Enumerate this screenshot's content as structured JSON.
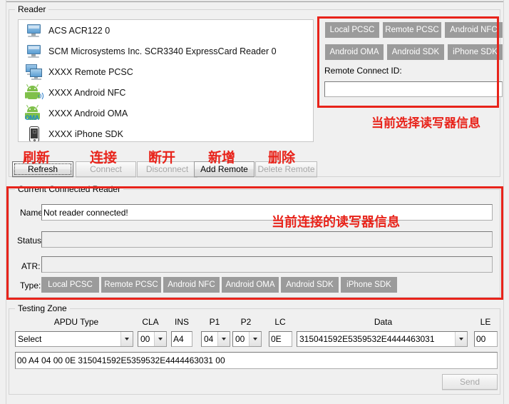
{
  "groups": {
    "reader": "Reader",
    "current": "Current Connected Reader",
    "testing": "Testing Zone"
  },
  "reader_list": [
    {
      "icon": "monitor-icon",
      "label": "ACS ACR122 0"
    },
    {
      "icon": "monitor-icon",
      "label": "SCM Microsystems Inc. SCR3340 ExpressCard Reader 0"
    },
    {
      "icon": "dual-monitor-icon",
      "label": "XXXX Remote PCSC"
    },
    {
      "icon": "android-nfc-icon",
      "label": "XXXX Android NFC"
    },
    {
      "icon": "android-oma-icon",
      "label": "XXXX Android OMA"
    },
    {
      "icon": "iphone-icon",
      "label": "XXXX iPhone SDK"
    }
  ],
  "type_chips": [
    "Local PCSC",
    "Remote PCSC",
    "Android NFC",
    "Android OMA",
    "Android SDK",
    "iPhone SDK"
  ],
  "remote": {
    "label": "Remote Connect ID:",
    "value": "",
    "placeholder": ""
  },
  "action_buttons": [
    {
      "label": "Refresh",
      "cn": "刷新",
      "disabled": false,
      "focused": true
    },
    {
      "label": "Connect",
      "cn": "连接",
      "disabled": true,
      "focused": false
    },
    {
      "label": "Disconnect",
      "cn": "断开",
      "disabled": true,
      "focused": false
    },
    {
      "label": "Add Remote",
      "cn": "新增",
      "disabled": false,
      "focused": false
    },
    {
      "label": "Delete Remote",
      "cn": "删除",
      "disabled": true,
      "focused": false
    }
  ],
  "connected": {
    "name_label": "Name:",
    "name_value": "Not reader connected!",
    "status_label": "Status:",
    "status_value": "",
    "atr_label": "ATR:",
    "atr_value": "",
    "type_label": "Type:"
  },
  "annotations": {
    "selected_reader": "当前选择读写器信息",
    "connected_reader": "当前连接的读写器信息"
  },
  "testing": {
    "headers": {
      "apdu": "APDU Type",
      "cla": "CLA",
      "ins": "INS",
      "p1": "P1",
      "p2": "P2",
      "lc": "LC",
      "data": "Data",
      "le": "LE"
    },
    "values": {
      "apdu": "Select",
      "cla": "00",
      "ins": "A4",
      "p1": "04",
      "p2": "00",
      "lc": "0E",
      "data": "315041592E5359532E4444463031",
      "le": "00"
    },
    "command_line": "00 A4 04 00 0E 315041592E5359532E4444463031 00",
    "send_label": "Send",
    "send_disabled": true
  },
  "colors": {
    "annotation_red": "#e8231a",
    "chip_gray": "#9b9b9b",
    "window_bg": "#f0f0f0"
  }
}
